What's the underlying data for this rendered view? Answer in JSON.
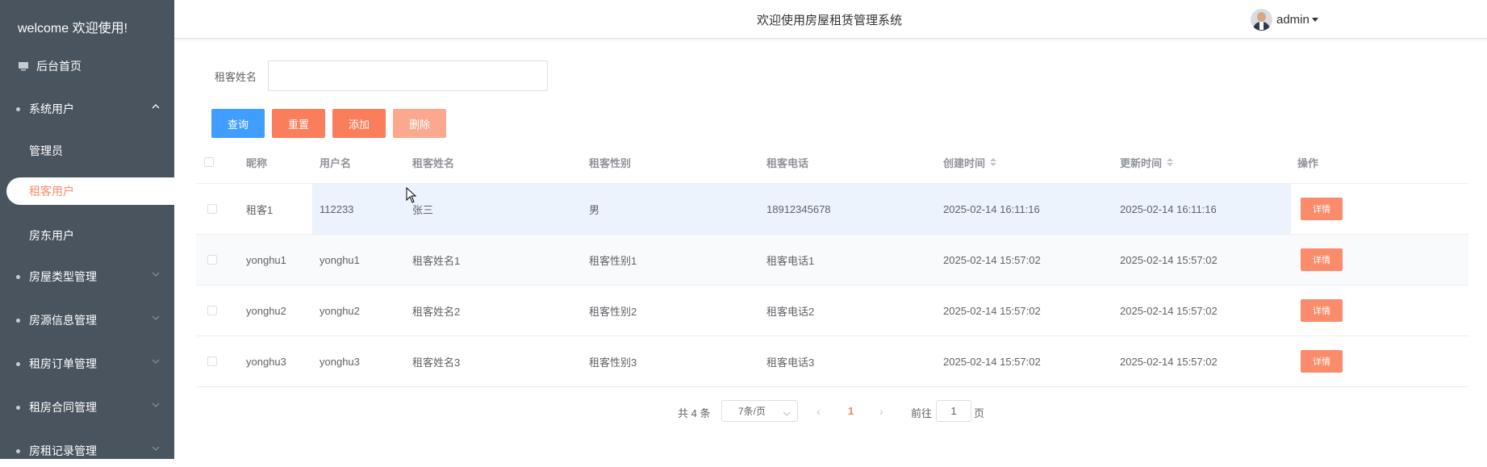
{
  "sidebar": {
    "brand": "welcome 欢迎使用!",
    "home": "后台首页",
    "groups": [
      {
        "label": "系统用户",
        "expanded": true
      },
      {
        "label": "房屋类型管理"
      },
      {
        "label": "房源信息管理"
      },
      {
        "label": "租房订单管理"
      },
      {
        "label": "租房合同管理"
      },
      {
        "label": "房租记录管理"
      }
    ],
    "sub_items": [
      {
        "label": "管理员"
      },
      {
        "label": "租客用户",
        "active": true
      },
      {
        "label": "房东用户"
      }
    ]
  },
  "header": {
    "title": "欢迎使用房屋租赁管理系统",
    "user": "admin"
  },
  "search": {
    "label": "租客姓名",
    "value": "",
    "placeholder": ""
  },
  "buttons": {
    "query": "查询",
    "reset": "重置",
    "add": "添加",
    "delete": "删除"
  },
  "table": {
    "columns": [
      "昵称",
      "用户名",
      "租客姓名",
      "租客性别",
      "租客电话",
      "创建时间",
      "更新时间",
      "操作"
    ],
    "rows": [
      {
        "nickname": "租客1",
        "username": "112233",
        "name": "张三",
        "gender": "男",
        "phone": "18912345678",
        "created": "2025-02-14 16:11:16",
        "updated": "2025-02-14 16:11:16",
        "action": "详情"
      },
      {
        "nickname": "yonghu1",
        "username": "yonghu1",
        "name": "租客姓名1",
        "gender": "租客性别1",
        "phone": "租客电话1",
        "created": "2025-02-14 15:57:02",
        "updated": "2025-02-14 15:57:02",
        "action": "详情"
      },
      {
        "nickname": "yonghu2",
        "username": "yonghu2",
        "name": "租客姓名2",
        "gender": "租客性别2",
        "phone": "租客电话2",
        "created": "2025-02-14 15:57:02",
        "updated": "2025-02-14 15:57:02",
        "action": "详情"
      },
      {
        "nickname": "yonghu3",
        "username": "yonghu3",
        "name": "租客姓名3",
        "gender": "租客性别3",
        "phone": "租客电话3",
        "created": "2025-02-14 15:57:02",
        "updated": "2025-02-14 15:57:02",
        "action": "详情"
      }
    ]
  },
  "pagination": {
    "total": "共 4 条",
    "page_size": "7条/页",
    "current_page": "1",
    "goto_label": "前往",
    "goto_value": "1",
    "goto_unit": "页"
  },
  "colors": {
    "sidebar_bg": "#4a545f",
    "accent": "#fa7e5b",
    "primary": "#409eff"
  }
}
